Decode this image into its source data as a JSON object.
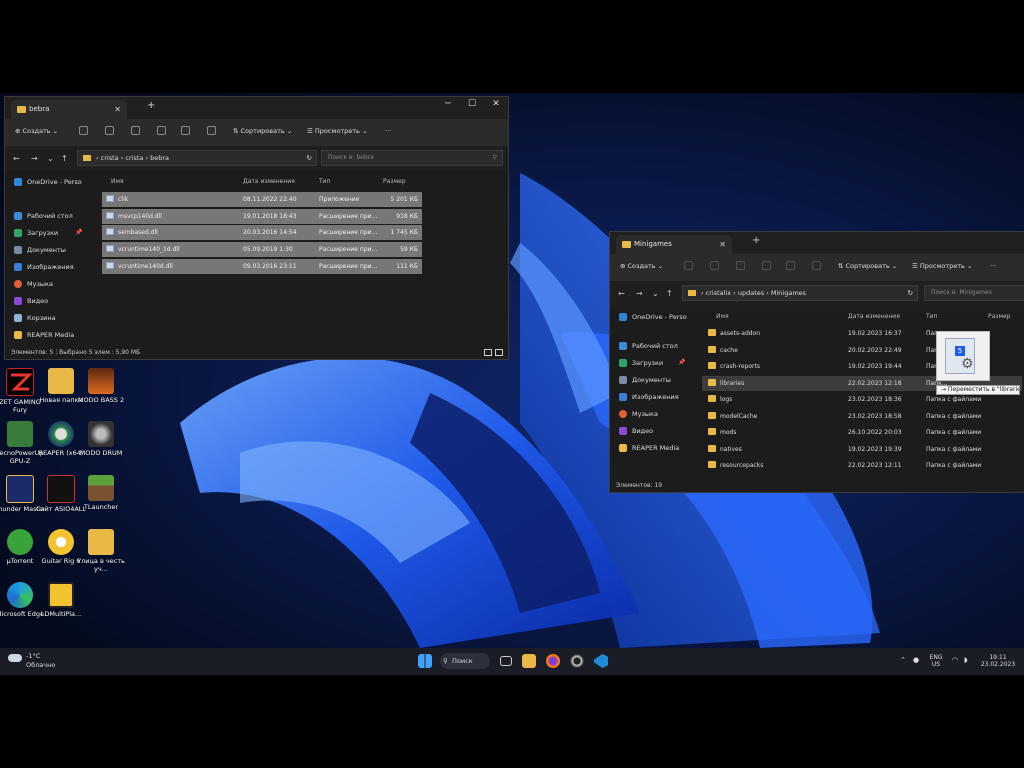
{
  "desktop": {
    "icons": [
      {
        "label": "ZET GAMING Fury"
      },
      {
        "label": "Новая папка"
      },
      {
        "label": "MODO BASS 2"
      },
      {
        "label": "TecnoPowerUp GPU-Z"
      },
      {
        "label": "REAPER (x64)"
      },
      {
        "label": "MODO DRUM"
      },
      {
        "label": "Thunder Master"
      },
      {
        "label": "Сайт ASIO4ALL"
      },
      {
        "label": "TLauncher"
      },
      {
        "label": "μTorrent"
      },
      {
        "label": "Guitar Rig 6"
      },
      {
        "label": "Улица в честь уч..."
      },
      {
        "label": "Microsoft Edge"
      },
      {
        "label": "LDMultiPla..."
      }
    ]
  },
  "window1": {
    "tab_title": "bebra",
    "toolbar": {
      "create": "Создать",
      "sort": "Сортировать",
      "view": "Просмотреть",
      "more": "···"
    },
    "path": {
      "p1": "crista",
      "p2": "crista",
      "p3": "bebra"
    },
    "search_placeholder": "Поиск в: bebra",
    "onedrive": "OneDrive - Perso",
    "nav": [
      {
        "label": "Рабочий стол"
      },
      {
        "label": "Загрузки"
      },
      {
        "label": "Документы"
      },
      {
        "label": "Изображения"
      },
      {
        "label": "Музыка"
      },
      {
        "label": "Видео"
      },
      {
        "label": "Корзина"
      },
      {
        "label": "REAPER Media"
      }
    ],
    "columns": {
      "name": "Имя",
      "date": "Дата изменения",
      "type": "Тип",
      "size": "Размер"
    },
    "files": [
      {
        "name": "clik",
        "date": "08.11.2022 22:40",
        "type": "Приложение",
        "size": "5 201 КБ"
      },
      {
        "name": "msvcp140d.dll",
        "date": "19.01.2018 18:43",
        "type": "Расширение при...",
        "size": "918 КБ"
      },
      {
        "name": "sembased.dll",
        "date": "20.03.2016 14:54",
        "type": "Расширение при...",
        "size": "1 745 КБ"
      },
      {
        "name": "vcruntime140_1d.dll",
        "date": "05.09.2019 1:30",
        "type": "Расширение при...",
        "size": "59 КБ"
      },
      {
        "name": "vcruntime140d.dll",
        "date": "09.03.2016 23:11",
        "type": "Расширение при...",
        "size": "111 КБ"
      }
    ],
    "status": {
      "count": "Элементов: 5",
      "selected": "Выбрано 5 элем.: 5,90 МБ"
    }
  },
  "window2": {
    "tab_title": "Minigames",
    "toolbar": {
      "create": "Создать",
      "sort": "Сортировать",
      "view": "Просмотреть",
      "more": "···"
    },
    "path": {
      "p1": "cristalix",
      "p2": "updates",
      "p3": "Minigames"
    },
    "search_placeholder": "Поиск в: Minigames",
    "onedrive": "OneDrive - Perso",
    "nav": [
      {
        "label": "Рабочий стол"
      },
      {
        "label": "Загрузки"
      },
      {
        "label": "Документы"
      },
      {
        "label": "Изображения"
      },
      {
        "label": "Музыка"
      },
      {
        "label": "Видео"
      },
      {
        "label": "REAPER Media"
      }
    ],
    "columns": {
      "name": "Имя",
      "date": "Дата изменения",
      "type": "Тип",
      "size": "Размер"
    },
    "folders": [
      {
        "name": "assets-addon",
        "date": "19.02.2023 16:37",
        "type": "Папк..."
      },
      {
        "name": "cache",
        "date": "20.02.2023 22:49",
        "type": "Папк..."
      },
      {
        "name": "crash-reports",
        "date": "19.02.2023 19:44",
        "type": "Папк..."
      },
      {
        "name": "libraries",
        "date": "22.02.2023 12:18",
        "type": "Папк..."
      },
      {
        "name": "logs",
        "date": "23.02.2023 18:36",
        "type": "Папка с файлами"
      },
      {
        "name": "modelCache",
        "date": "23.02.2023 18:58",
        "type": "Папка с файлами"
      },
      {
        "name": "mods",
        "date": "26.10.2022 20:03",
        "type": "Папка с файлами"
      },
      {
        "name": "natives",
        "date": "19.02.2023 19:39",
        "type": "Папка с файлами"
      },
      {
        "name": "resourcepacks",
        "date": "22.02.2023 12:11",
        "type": "Папка с файлами"
      }
    ],
    "status": {
      "count": "Элементов: 19"
    }
  },
  "drag": {
    "tooltip": "→ Переместить в \"libraries\"",
    "badge": "5"
  },
  "taskbar": {
    "weather_temp": "-1°C",
    "weather_text": "Облачно",
    "search": "Поиск",
    "lang": "ENG",
    "region": "US",
    "time": "19:11",
    "date": "23.02.2023"
  }
}
